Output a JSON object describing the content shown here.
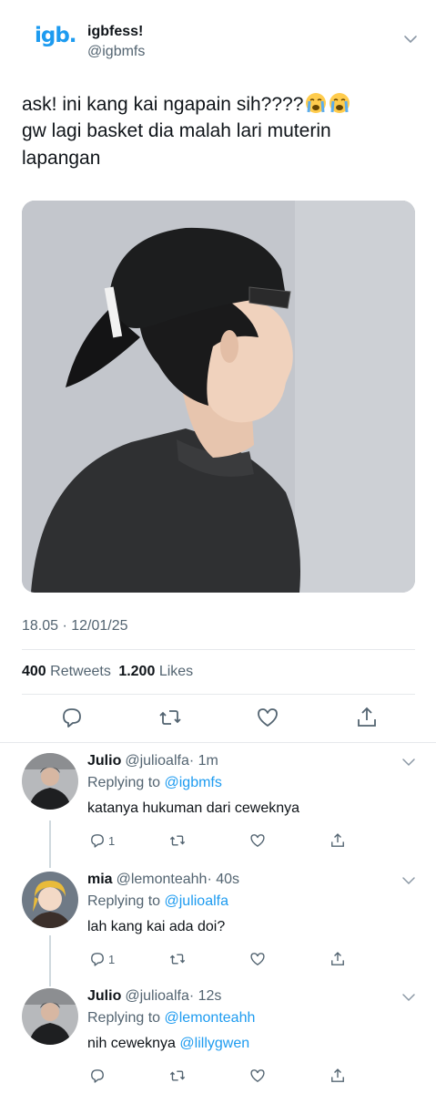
{
  "main_tweet": {
    "avatar_text": "igb.",
    "name": "igbfess!",
    "handle": "@igbmfs",
    "text_line1": "ask! ini kang kai ngapain sih????",
    "text_line2": "gw lagi basket dia malah lari muterin",
    "text_line3": "lapangan",
    "emoji": "loudly-crying-face",
    "timestamp": "18.05 · 12/01/25",
    "retweets_count": "400",
    "retweets_label": "Retweets",
    "likes_count": "1.200",
    "likes_label": "Likes"
  },
  "replies": [
    {
      "name": "Julio",
      "handle": "@julioalfa",
      "time": "· 1m",
      "replying_label": "Replying to",
      "replying_to": "@igbmfs",
      "text": "katanya hukuman dari ceweknya",
      "mention": "",
      "reply_count": "1"
    },
    {
      "name": "mia",
      "handle": "@lemonteahh",
      "time": "· 40s",
      "replying_label": "Replying to",
      "replying_to": "@julioalfa",
      "text": "lah kang kai ada doi?",
      "mention": "",
      "reply_count": "1"
    },
    {
      "name": "Julio",
      "handle": "@julioalfa",
      "time": "· 12s",
      "replying_label": "Replying to",
      "replying_to": "@lemonteahh",
      "text": "nih ceweknya",
      "mention": "@lillygwen",
      "reply_count": ""
    }
  ],
  "colors": {
    "accent": "#1d9bf0",
    "text": "#0f1419",
    "secondary": "#536471",
    "divider": "#e6e9ec"
  }
}
